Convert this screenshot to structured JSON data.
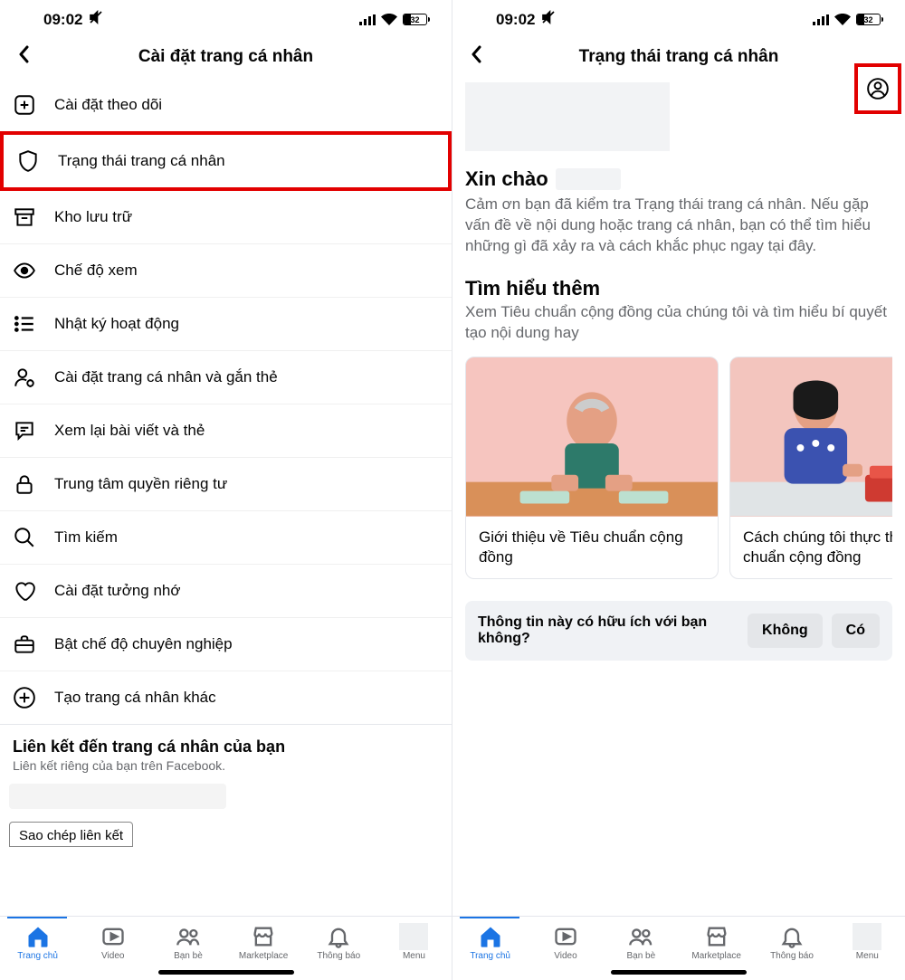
{
  "status": {
    "time": "09:02",
    "battery": "32"
  },
  "left": {
    "title": "Cài đặt trang cá nhân",
    "items": [
      {
        "label": "Cài đặt theo dõi"
      },
      {
        "label": "Trạng thái trang cá nhân"
      },
      {
        "label": "Kho lưu trữ"
      },
      {
        "label": "Chế độ xem"
      },
      {
        "label": "Nhật ký hoạt động"
      },
      {
        "label": "Cài đặt trang cá nhân và gắn thẻ"
      },
      {
        "label": "Xem lại bài viết và thẻ"
      },
      {
        "label": "Trung tâm quyền riêng tư"
      },
      {
        "label": "Tìm kiếm"
      },
      {
        "label": "Cài đặt tưởng nhớ"
      },
      {
        "label": "Bật chế độ chuyên nghiệp"
      },
      {
        "label": "Tạo trang cá nhân khác"
      }
    ],
    "link_section": {
      "title": "Liên kết đến trang cá nhân của bạn",
      "subtitle": "Liên kết riêng của bạn trên Facebook.",
      "copy": "Sao chép liên kết"
    }
  },
  "right": {
    "title": "Trạng thái trang cá nhân",
    "hello": "Xin chào",
    "hello_body": "Cảm ơn bạn đã kiểm tra Trạng thái trang cá nhân. Nếu gặp vấn đề về nội dung hoặc trang cá nhân, bạn có thể tìm hiểu những gì đã xảy ra và cách khắc phục ngay tại đây.",
    "learn_more": "Tìm hiểu thêm",
    "learn_more_sub": "Xem Tiêu chuẩn cộng đồng của chúng tôi và tìm hiểu bí quyết tạo nội dung hay",
    "cards": [
      {
        "caption": "Giới thiệu về Tiêu chuẩn cộng đồng"
      },
      {
        "caption": "Cách chúng tôi thực thi Tiêu chuẩn cộng đồng"
      }
    ],
    "feedback": {
      "q": "Thông tin này có hữu ích với bạn không?",
      "no": "Không",
      "yes": "Có"
    }
  },
  "nav": [
    {
      "label": "Trang chủ"
    },
    {
      "label": "Video"
    },
    {
      "label": "Bạn bè"
    },
    {
      "label": "Marketplace"
    },
    {
      "label": "Thông báo"
    },
    {
      "label": "Menu"
    }
  ]
}
